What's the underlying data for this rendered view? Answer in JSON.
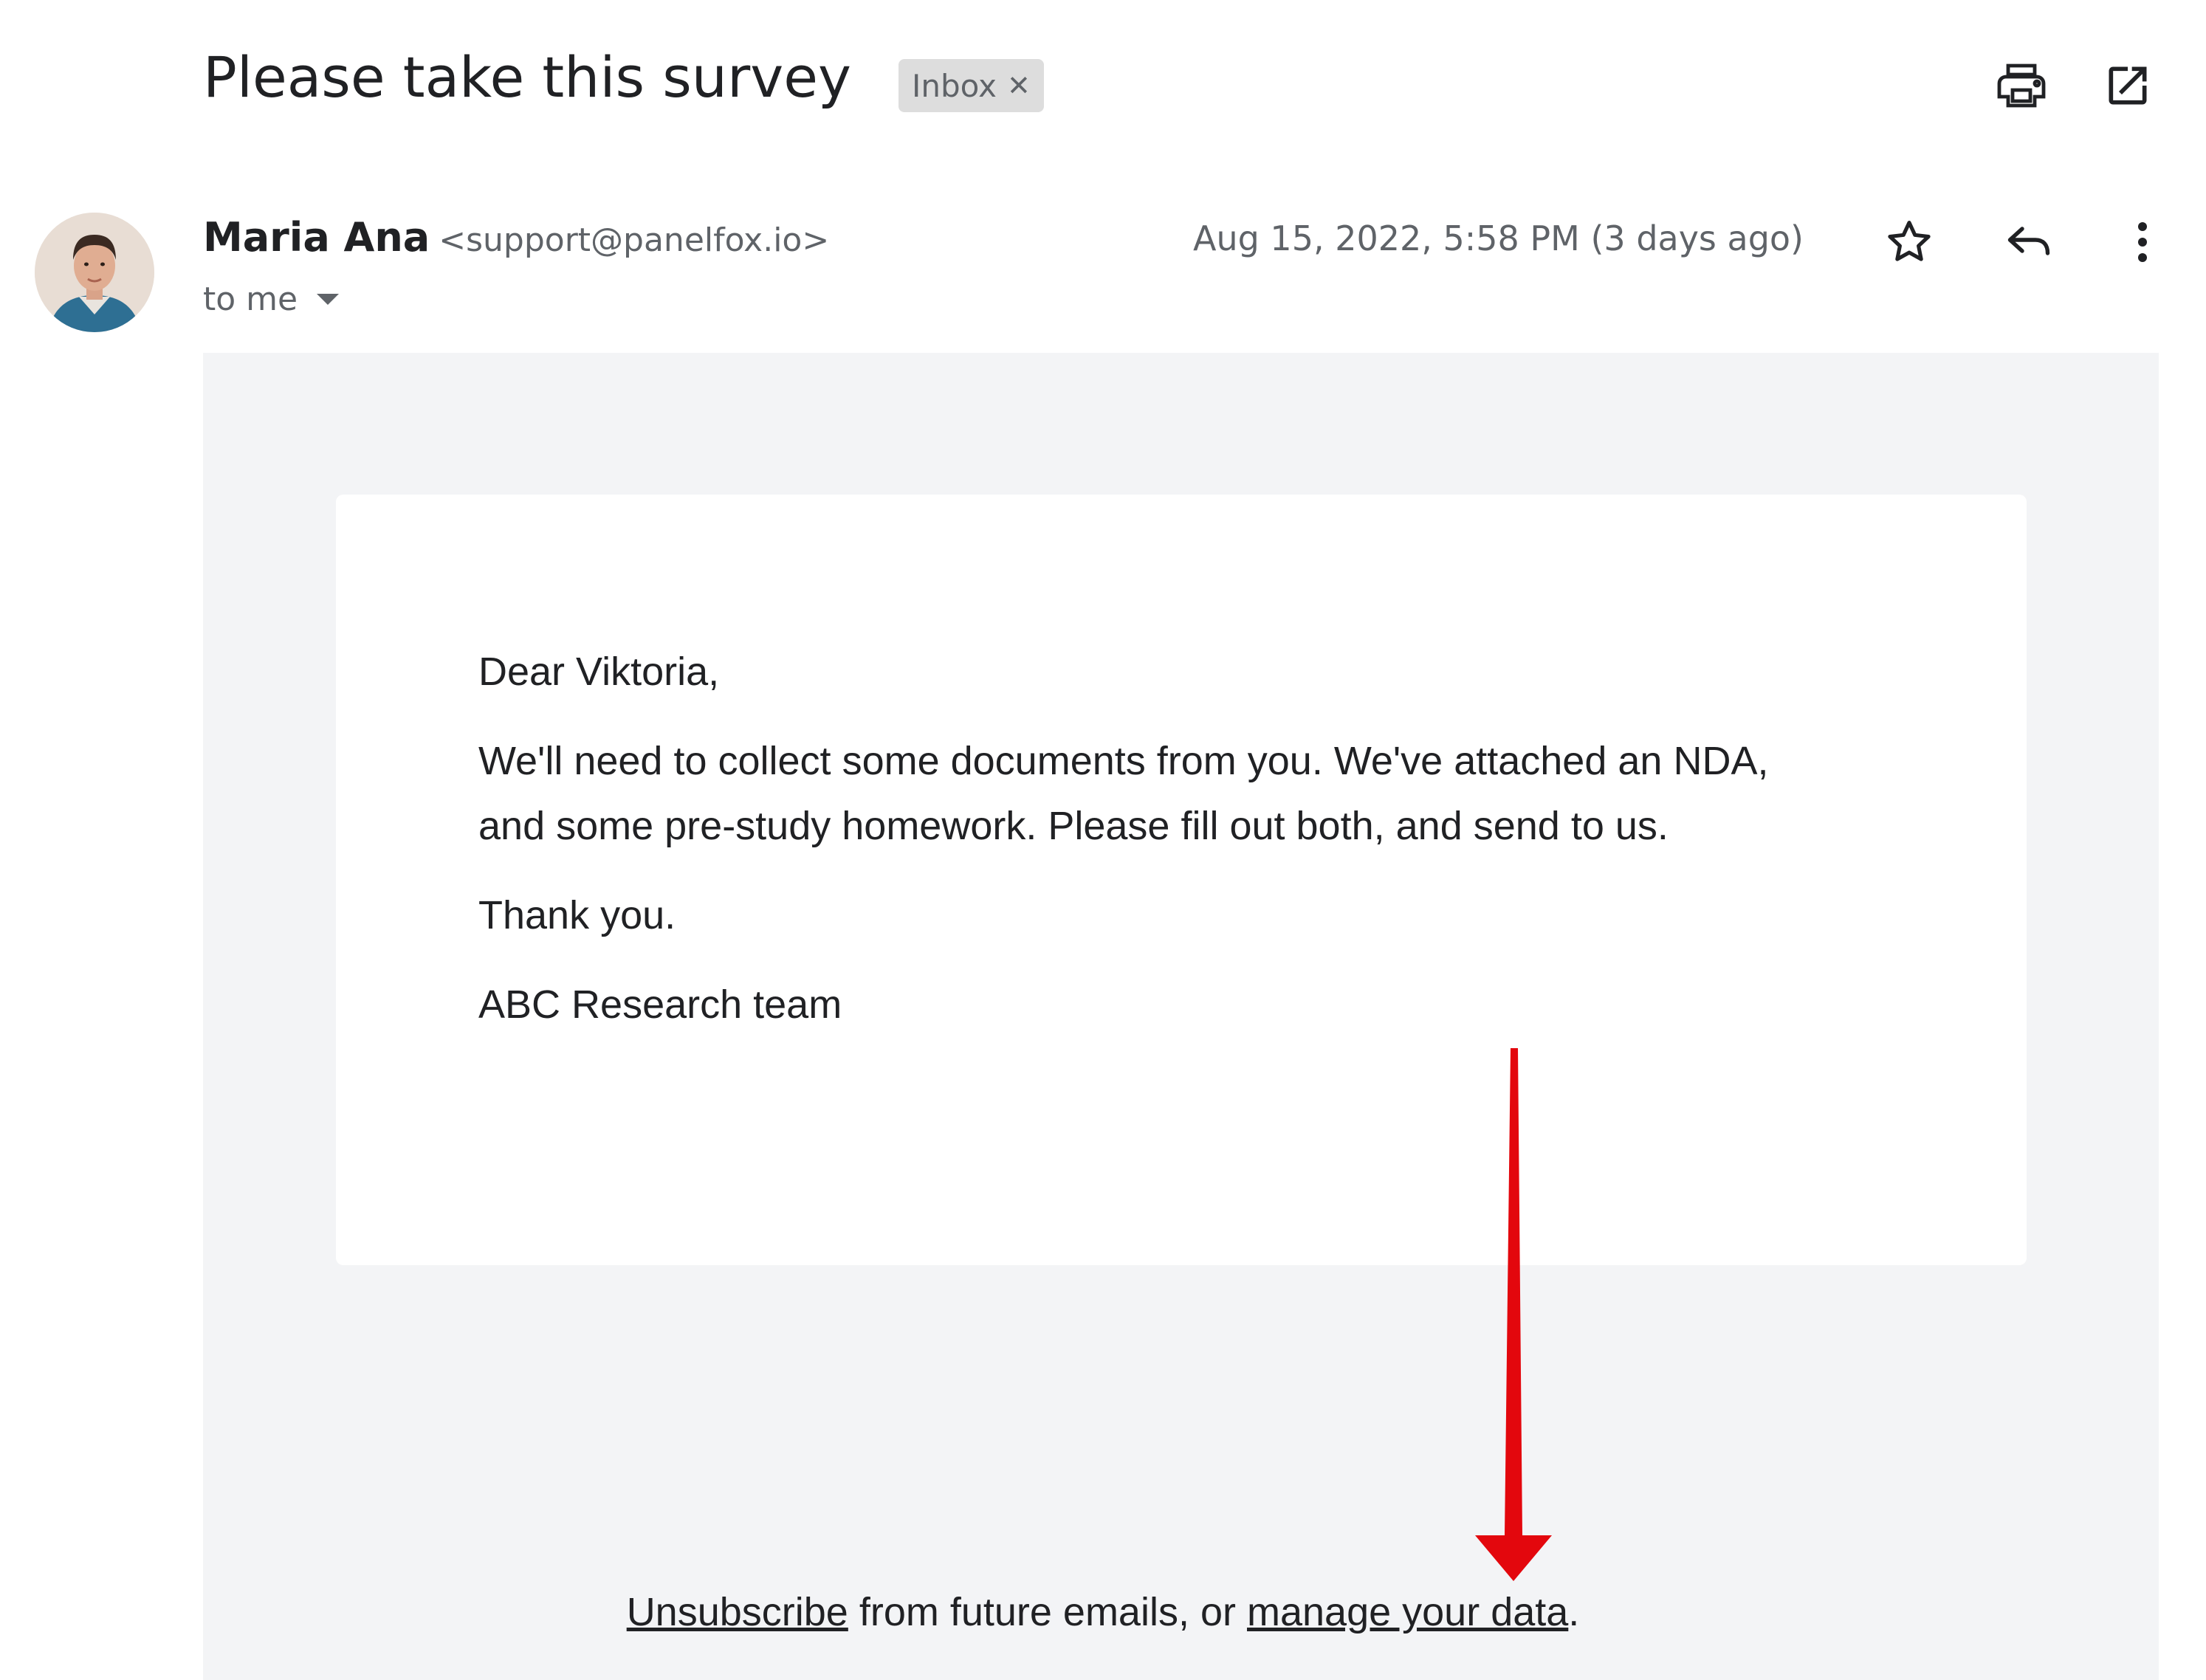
{
  "email": {
    "subject": "Please take this survey",
    "label": "Inbox",
    "sender_name": "Maria Ana",
    "sender_email": "<support@panelfox.io>",
    "recipient": "to me",
    "date": "Aug 15, 2022, 5:58 PM (3 days ago)"
  },
  "icons": {
    "print": "print-icon",
    "open_new_window": "open-in-new-window-icon",
    "star": "star-icon",
    "reply": "reply-icon",
    "more": "more-vertical-icon",
    "label_remove": "close-icon",
    "recipient_dropdown": "chevron-down-icon",
    "annotation": "red-arrow"
  },
  "body": {
    "greeting": "Dear Viktoria,",
    "paragraph_line1": "We'll need to collect some documents from you. We've attached an NDA,",
    "paragraph_line2": "and some pre-study homework. Please fill out both, and send to us.",
    "closing": "Thank you.",
    "signature": "ABC Research team"
  },
  "footer": {
    "unsubscribe_link": "Unsubscribe",
    "middle_text": " from future emails, or ",
    "manage_link": "manage your data",
    "end_text": "."
  },
  "colors": {
    "message_background": "#f3f4f6",
    "card": "#ffffff",
    "annotation_arrow": "#e3070d",
    "label_chip": "#dddddd",
    "secondary_text": "#5f6368"
  }
}
